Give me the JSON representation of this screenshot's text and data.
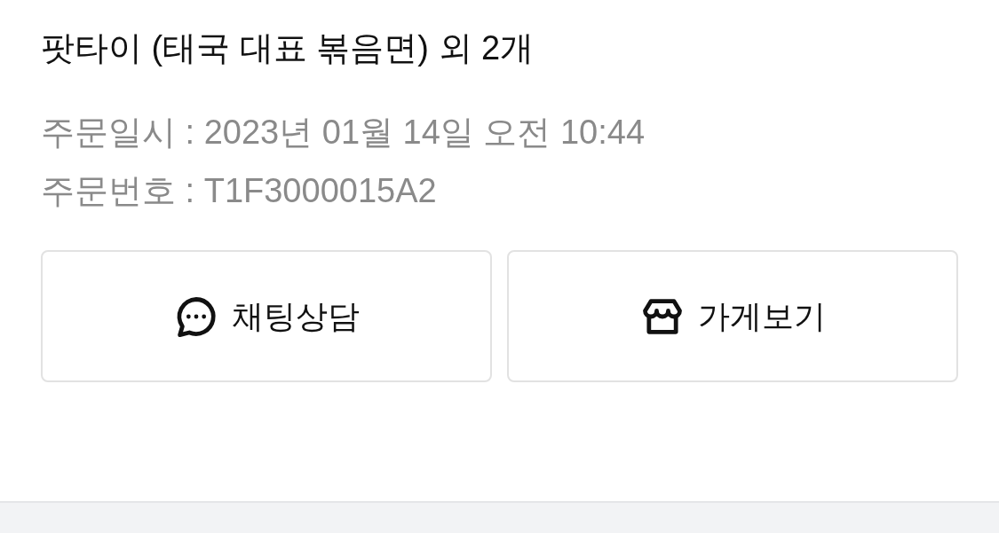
{
  "order": {
    "title": "팟타이 (태국 대표 볶음면) 외 2개",
    "details": [
      {
        "label": "주문일시 : 2023년 01월 14일 오전 10:44"
      },
      {
        "label": "주문번호 : T1F3000015A2"
      }
    ]
  },
  "buttons": [
    {
      "kind": "chat",
      "label": "채팅상담"
    },
    {
      "kind": "store",
      "label": "가게보기"
    }
  ]
}
